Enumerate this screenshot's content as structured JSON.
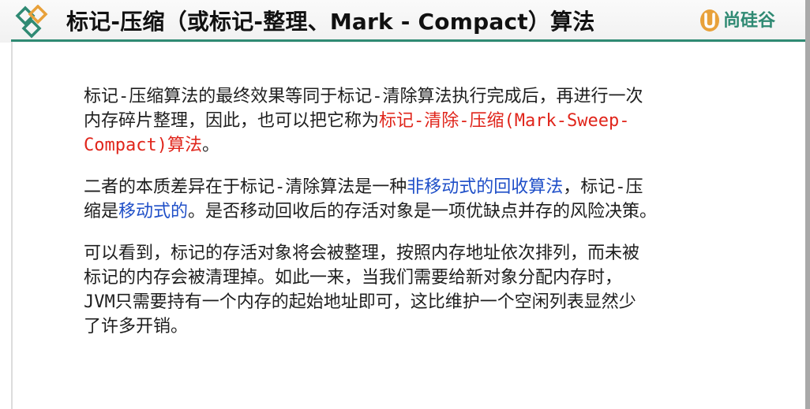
{
  "colors": {
    "accent_green": "#2f8a73",
    "highlight_red": "#e0251b",
    "highlight_blue": "#1f4fc8"
  },
  "header": {
    "title": "标记-压缩（或标记-整理、Mark - Compact）算法",
    "brand": "尚硅谷",
    "brand_icon": "u-logo-icon",
    "logo_icon": "diamond-logo-icon"
  },
  "body": {
    "p1": {
      "l1": "标记-压缩算法的最终效果等同于标记-清除算法执行完成后，再进行一次",
      "l2_a": "内存碎片整理，因此，也可以把它称为",
      "l2_red": "标记-清除-压缩(Mark-Sweep-",
      "l3_red": "Compact)算法",
      "l3_b": "。"
    },
    "p2": {
      "l1_a": "二者的本质差异在于标记-清除算法是一种",
      "l1_blue": "非移动式的回收算法",
      "l1_b": "，标记-压",
      "l2_a": "缩是",
      "l2_blue": "移动式的",
      "l2_b": "。是否移动回收后的存活对象是一项优缺点并存的风险决策。"
    },
    "p3": {
      "l1": "可以看到，标记的存活对象将会被整理，按照内存地址依次排列，而未被",
      "l2": "标记的内存会被清理掉。如此一来，当我们需要给新对象分配内存时，",
      "l3": "JVM只需要持有一个内存的起始地址即可，这比维护一个空闲列表显然少",
      "l4": "了许多开销。"
    }
  }
}
